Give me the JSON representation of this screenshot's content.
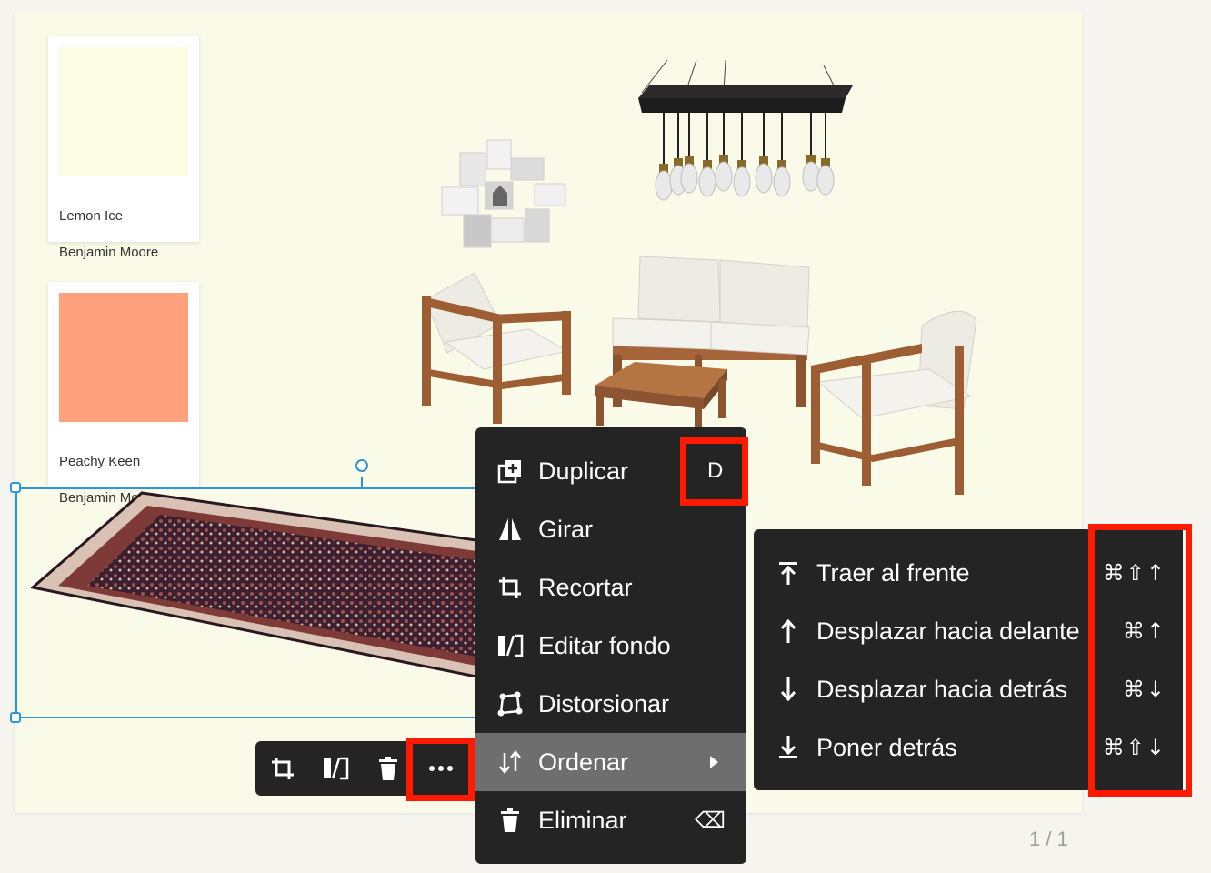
{
  "swatches": [
    {
      "name": "Lemon Ice",
      "brand": "Benjamin Moore",
      "color": "#fcfbe3"
    },
    {
      "name": "Peachy Keen",
      "brand": "Benjamin Moore",
      "color": "#ffa17d"
    }
  ],
  "canvas_items": [
    "photo-collage",
    "pendant-chandelier",
    "outdoor-sofa",
    "armchair-left",
    "armchair-right",
    "coffee-table",
    "persian-rug"
  ],
  "toolbar": {
    "crop_icon": "crop-icon",
    "edit_bg_icon": "edit-background-icon",
    "delete_icon": "trash-icon",
    "more_icon": "more-dots-icon"
  },
  "context_menu": {
    "items": [
      {
        "label": "Duplicar",
        "shortcut": "D",
        "icon": "duplicate-icon"
      },
      {
        "label": "Girar",
        "shortcut": "",
        "icon": "flip-icon"
      },
      {
        "label": "Recortar",
        "shortcut": "",
        "icon": "crop-icon"
      },
      {
        "label": "Editar fondo",
        "shortcut": "",
        "icon": "edit-background-icon"
      },
      {
        "label": "Distorsionar",
        "shortcut": "",
        "icon": "distort-icon"
      },
      {
        "label": "Ordenar",
        "shortcut": "",
        "icon": "arrange-icon"
      },
      {
        "label": "Eliminar",
        "shortcut": "⌫",
        "icon": "trash-icon"
      }
    ]
  },
  "arrange_submenu": {
    "items": [
      {
        "label": "Traer al frente",
        "shortcut": "⌘⇧↑",
        "icon": "bring-to-front-icon"
      },
      {
        "label": "Desplazar hacia delante",
        "shortcut": "⌘↑",
        "icon": "move-forward-icon"
      },
      {
        "label": "Desplazar hacia detrás",
        "shortcut": "⌘↓",
        "icon": "move-backward-icon"
      },
      {
        "label": "Poner detrás",
        "shortcut": "⌘⇧↓",
        "icon": "send-to-back-icon"
      }
    ]
  },
  "page_indicator": "1 / 1",
  "colors": {
    "highlight": "#ff1a00",
    "selection": "#2f95d3",
    "menu_bg": "#242424",
    "active_item": "#6e6e6e"
  }
}
